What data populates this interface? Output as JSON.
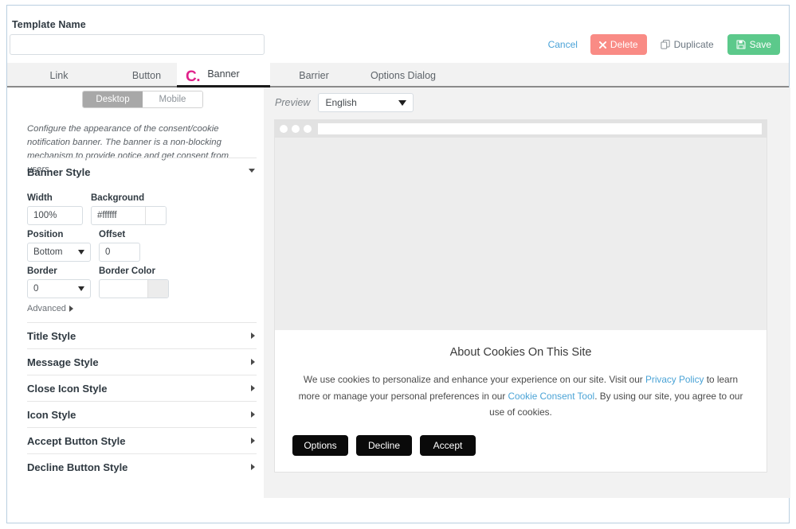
{
  "header": {
    "template_name_label": "Template Name",
    "template_name_value": "",
    "template_name_placeholder": ""
  },
  "actions": {
    "cancel": "Cancel",
    "delete": "Delete",
    "duplicate": "Duplicate",
    "save": "Save"
  },
  "tabs": [
    {
      "label": "Link",
      "active": false
    },
    {
      "label": "Button",
      "active": false
    },
    {
      "label": "Banner",
      "active": true
    },
    {
      "label": "Barrier",
      "active": false
    },
    {
      "label": "Options Dialog",
      "active": false
    }
  ],
  "annotation": {
    "marker": "C.",
    "color": "#e0218a"
  },
  "config": {
    "device_toggle": {
      "desktop": "Desktop",
      "mobile": "Mobile",
      "selected": "Desktop"
    },
    "description": "Configure the appearance of the consent/cookie notification banner. The banner is a non-blocking mechanism to provide notice and get consent from users.",
    "banner_style": {
      "title": "Banner Style",
      "width_label": "Width",
      "width_value": "100%",
      "background_label": "Background",
      "background_value": "#ffffff",
      "position_label": "Position",
      "position_value": "Bottom",
      "offset_label": "Offset",
      "offset_value": "0",
      "border_label": "Border",
      "border_value": "0",
      "border_color_label": "Border Color",
      "border_color_value": ""
    },
    "advanced_label": "Advanced",
    "sections": [
      {
        "label": "Title Style"
      },
      {
        "label": "Message Style"
      },
      {
        "label": "Close Icon Style"
      },
      {
        "label": "Icon Style"
      },
      {
        "label": "Accept Button Style"
      },
      {
        "label": "Decline Button Style"
      }
    ]
  },
  "preview": {
    "label": "Preview",
    "language": "English",
    "cookie_banner": {
      "title": "About Cookies On This Site",
      "msg_part1": "We use cookies to personalize and enhance your experience on our site. Visit our ",
      "link1": "Privacy Policy",
      "msg_part2": " to learn more or manage your personal preferences in our ",
      "link2": "Cookie Consent Tool",
      "msg_part3": ". By using our site, you agree to our use of cookies.",
      "buttons": {
        "options": "Options",
        "decline": "Decline",
        "accept": "Accept"
      }
    }
  }
}
